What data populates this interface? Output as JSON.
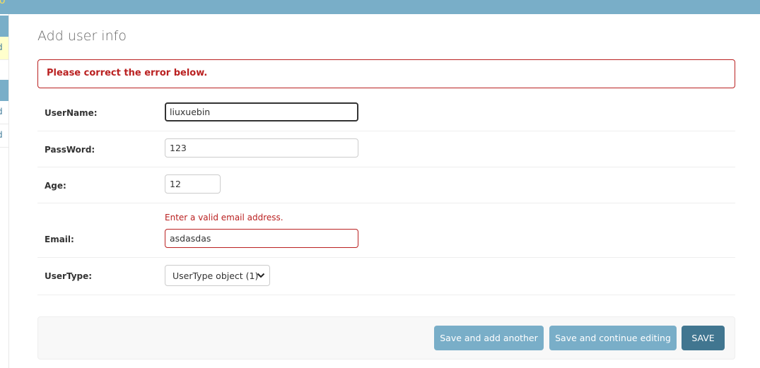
{
  "topbar": {
    "partial_text": "fo"
  },
  "sidebar": {
    "rows": [
      "d",
      "d",
      "d"
    ]
  },
  "page": {
    "title": "Add user info"
  },
  "error_note": "Please correct the error below.",
  "fields": {
    "username": {
      "label": "UserName:",
      "value": "liuxuebin"
    },
    "password": {
      "label": "PassWord:",
      "value": "123"
    },
    "age": {
      "label": "Age:",
      "value": "12"
    },
    "email": {
      "label": "Email:",
      "value": "asdasdas",
      "error": "Enter a valid email address."
    },
    "usertype": {
      "label": "UserType:",
      "selected": "UserType object (1)"
    }
  },
  "buttons": {
    "save_add_another": "Save and add another",
    "save_continue": "Save and continue editing",
    "save": "SAVE"
  },
  "colors": {
    "header": "#79aec8",
    "error": "#ba2121",
    "button_light": "#79aec8",
    "button_dark": "#417690"
  }
}
